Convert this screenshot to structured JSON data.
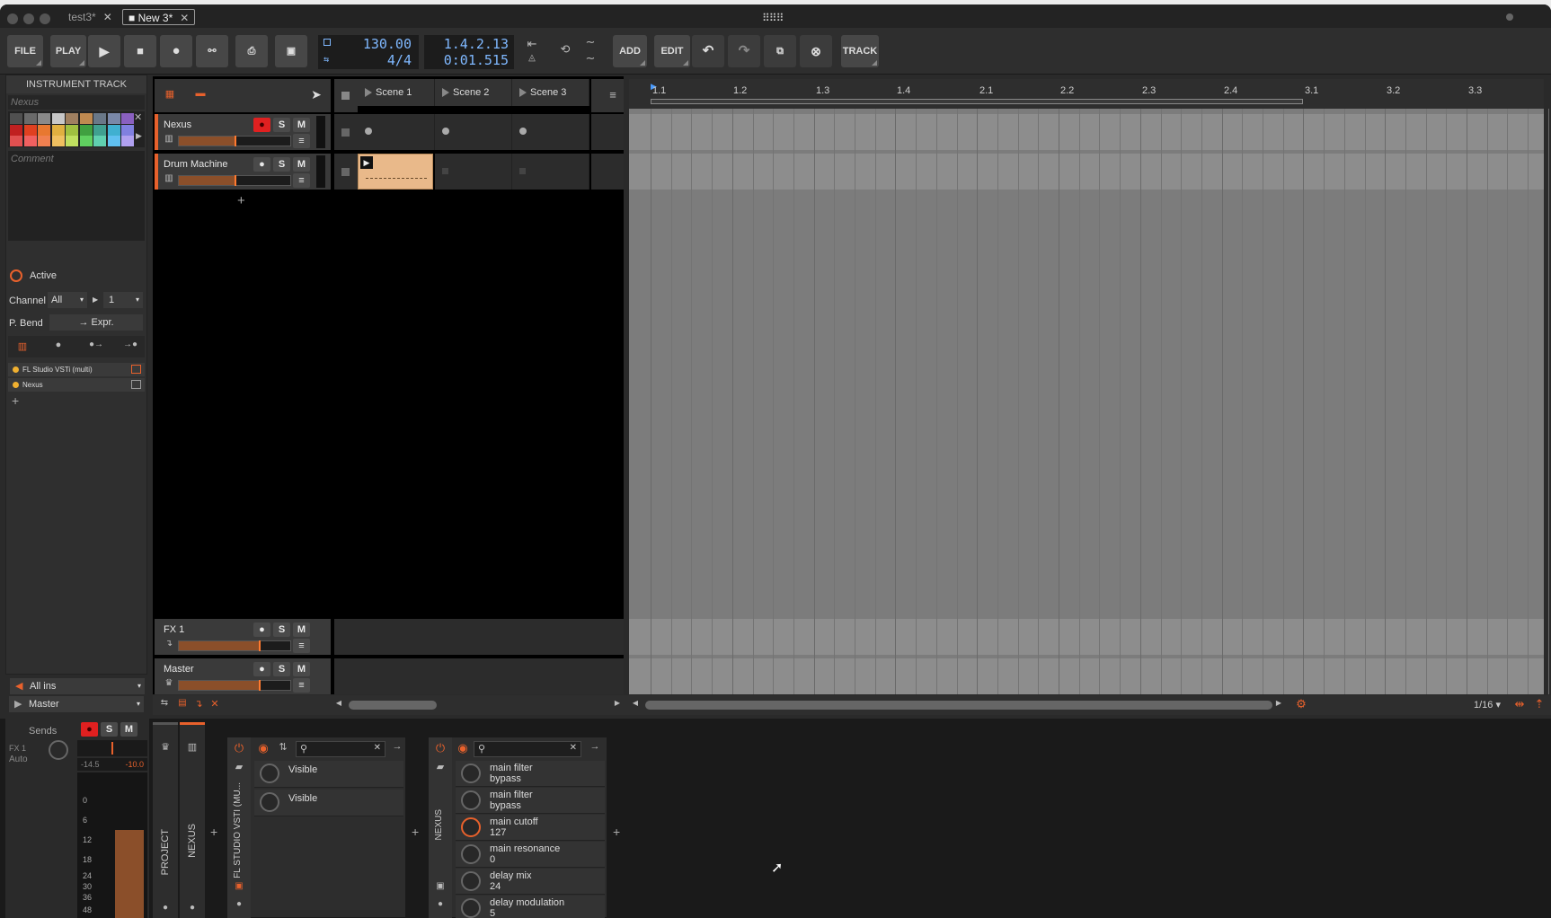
{
  "tabs": [
    {
      "label": "test3*",
      "active": false
    },
    {
      "label": "New 3*",
      "active": true
    }
  ],
  "toolbar": {
    "file": "FILE",
    "play": "PLAY",
    "add": "ADD",
    "edit": "EDIT",
    "track": "TRACK",
    "tempo": "130.00",
    "signature": "4/4",
    "position": "1.4.2.13",
    "time": "0:01.515"
  },
  "inspector": {
    "title": "INSTRUMENT TRACK",
    "name_placeholder": "Nexus",
    "comment_placeholder": "Comment",
    "active": "Active",
    "channel_label": "Channel",
    "channel_value": "All",
    "channel_num": "1",
    "pbend_label": "P. Bend",
    "pbend_value": "→ Expr.",
    "devices": [
      "FL Studio VSTi (multi)",
      "Nexus"
    ],
    "input": "All ins",
    "output": "Master"
  },
  "tracks": [
    {
      "name": "Nexus"
    },
    {
      "name": "Drum Machine"
    }
  ],
  "effect_tracks": [
    {
      "name": "FX 1"
    },
    {
      "name": "Master"
    }
  ],
  "scenes": [
    "Scene 1",
    "Scene 2",
    "Scene 3"
  ],
  "ruler": [
    "1.1",
    "1.2",
    "1.3",
    "1.4",
    "2.1",
    "2.2",
    "2.3",
    "2.4",
    "3.1",
    "3.2",
    "3.3"
  ],
  "grid": "1/16",
  "mixer": {
    "sends": "Sends",
    "fx": "FX 1",
    "auto": "Auto",
    "db1": "-14.5",
    "db2": "-10.0",
    "scale": [
      "0",
      "6",
      "12",
      "18",
      "24",
      "30",
      "36",
      "48"
    ],
    "s": "S",
    "m": "M"
  },
  "chain": {
    "project": "PROJECT",
    "nexus": "NEXUS",
    "fl": "FL STUDIO VSTI (MU...",
    "nexus2": "NEXUS"
  },
  "fl_params": [
    "Visible",
    "Visible"
  ],
  "nexus_params": [
    {
      "name": "main filter",
      "value": "bypass"
    },
    {
      "name": "main filter",
      "value": "bypass"
    },
    {
      "name": "main cutoff",
      "value": "127"
    },
    {
      "name": "main resonance",
      "value": "0"
    },
    {
      "name": "delay mix",
      "value": "24"
    },
    {
      "name": "delay modulation",
      "value": "5"
    }
  ],
  "colors": {
    "accent": "#e8612c",
    "clip": "#e9b98a",
    "transport_text": "#7fb8ff"
  }
}
